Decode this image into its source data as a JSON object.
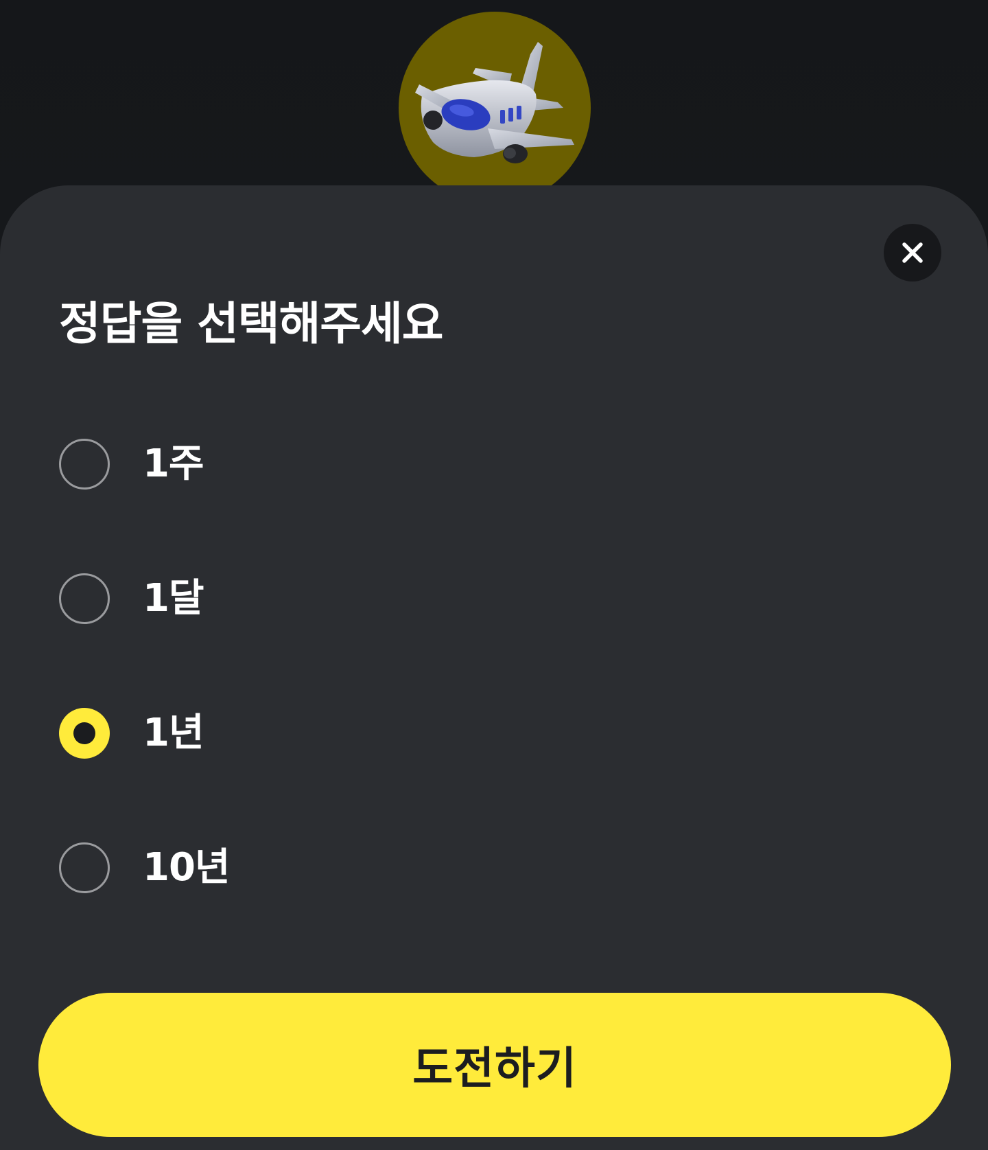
{
  "hero": {
    "icon": "airplane-icon",
    "badge_color": "#6b5f00"
  },
  "close_button": {
    "icon": "close-icon"
  },
  "question": {
    "title": "정답을 선택해주세요"
  },
  "options": [
    {
      "label": "1주",
      "selected": false
    },
    {
      "label": "1달",
      "selected": false
    },
    {
      "label": "1년",
      "selected": true
    },
    {
      "label": "10년",
      "selected": false
    }
  ],
  "submit": {
    "label": "도전하기"
  },
  "colors": {
    "accent": "#ffeb3b",
    "sheet": "#2b2d31",
    "background": "#141619",
    "text": "#ffffff"
  }
}
